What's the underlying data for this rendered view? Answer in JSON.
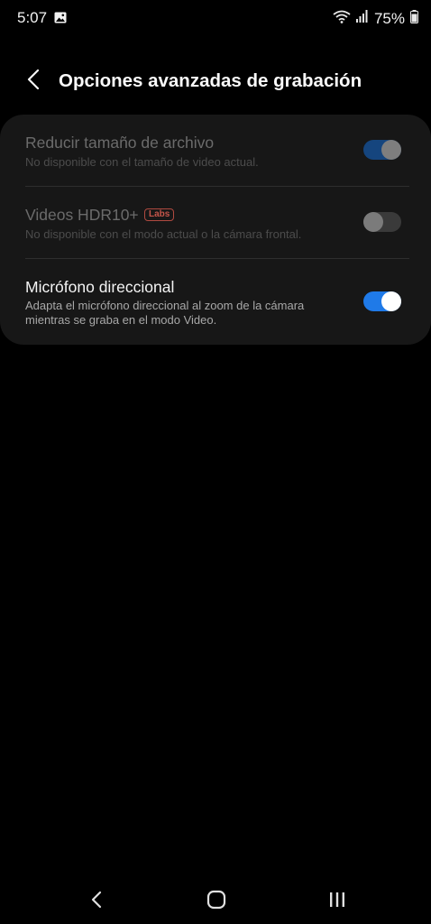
{
  "status_bar": {
    "time": "5:07",
    "battery_text": "75%",
    "icons": [
      "gallery-icon",
      "wifi-icon",
      "signal-icon",
      "battery-icon"
    ]
  },
  "header": {
    "back_icon": "chevron-left-icon",
    "title": "Opciones avanzadas de grabación"
  },
  "settings": [
    {
      "title": "Reducir tamaño de archivo",
      "subtitle": "No disponible con el tamaño de video actual.",
      "enabled": false,
      "toggle_on": true
    },
    {
      "title": "Videos HDR10+",
      "badge": "Labs",
      "subtitle": "No disponible con el modo actual o la cámara frontal.",
      "enabled": false,
      "toggle_on": false
    },
    {
      "title": "Micrófono direccional",
      "subtitle": "Adapta el micrófono direccional al zoom de la cámara mientras se graba en el modo Video.",
      "enabled": true,
      "toggle_on": true
    }
  ],
  "nav_bar": {
    "icons": [
      "back-icon",
      "home-icon",
      "recents-icon"
    ]
  },
  "colors": {
    "background": "#000000",
    "card": "#171717",
    "accent": "#1f7ae8",
    "badge": "#c4554a"
  }
}
